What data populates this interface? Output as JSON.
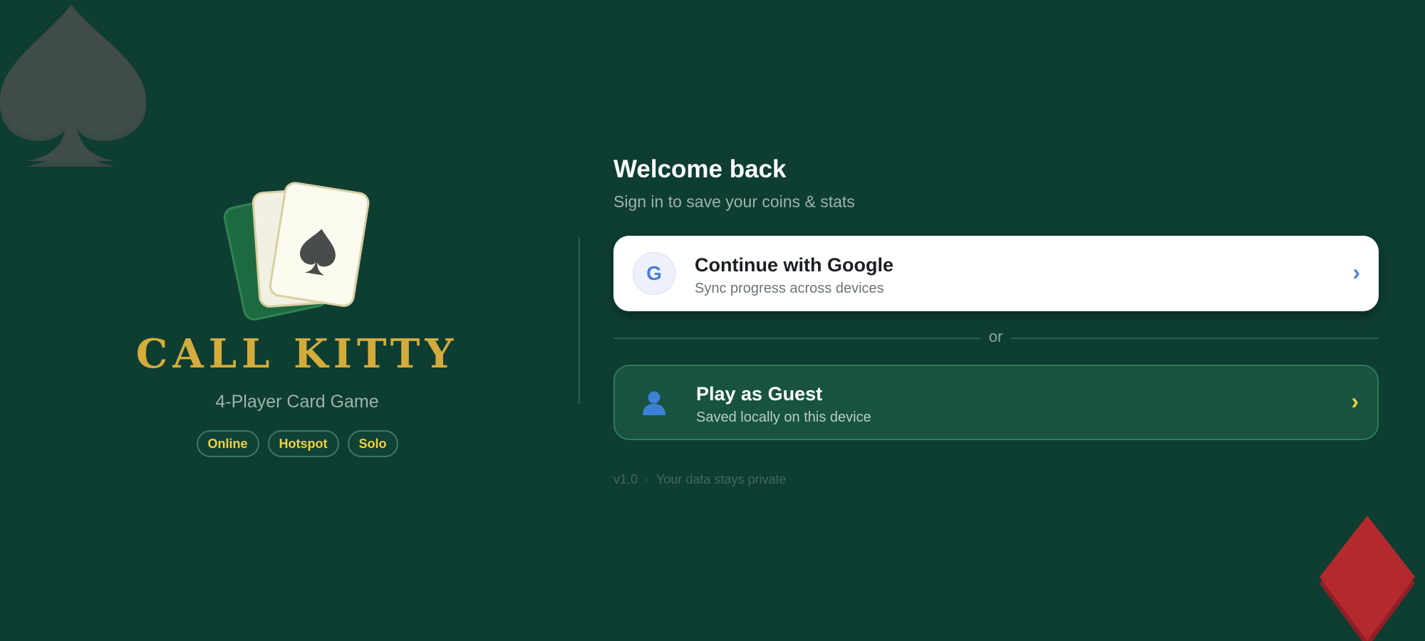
{
  "app": {
    "title": "CALL KITTY",
    "subtitle": "4-Player Card Game",
    "modes": [
      "Online",
      "Hotspot",
      "Solo"
    ]
  },
  "signin": {
    "heading": "Welcome back",
    "subheading": "Sign in to save your coins & stats",
    "google": {
      "icon_letter": "G",
      "title": "Continue with Google",
      "subtitle": "Sync progress across devices",
      "chevron": "›"
    },
    "separator": "or",
    "guest": {
      "icon": "user-icon",
      "title": "Play as Guest",
      "subtitle": "Saved locally on this device",
      "chevron": "›"
    }
  },
  "footer": {
    "version": "v1.0",
    "dot": "·",
    "note": "Your data stays private"
  },
  "icons": {
    "spade": "spade-icon",
    "diamond": "diamond-icon",
    "google": "google-icon",
    "guest": "user-icon"
  },
  "colors": {
    "background": "#0e3d32",
    "brand_gold": "#d4ac3c",
    "badge_text": "#f2cf3f",
    "google_card": "#ffffff",
    "guest_card": "#17533f",
    "diamond_red": "#b3292d"
  }
}
